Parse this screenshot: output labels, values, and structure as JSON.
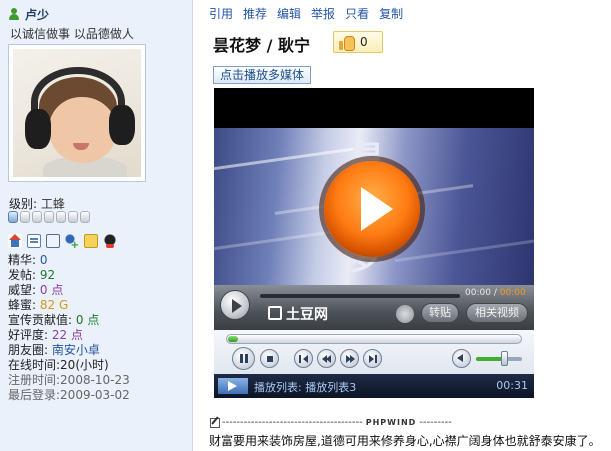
{
  "user": {
    "name": "卢少",
    "motto": "以诚信做事 以品德做人",
    "level_label": "级别:",
    "level_value": "工蜂",
    "stars_total": 7,
    "stars_on": 1,
    "icons": [
      "home-icon",
      "profile-card-icon",
      "document-icon",
      "add-friend-icon",
      "message-icon",
      "qq-icon"
    ]
  },
  "stats": {
    "jinghua_label": "精华:",
    "jinghua_value": "0",
    "posts_label": "发帖:",
    "posts_value": "92",
    "prestige_label": "威望:",
    "prestige_value": "0 点",
    "honey_label": "蜂蜜:",
    "honey_value": "82 G",
    "contrib_label": "宣传贡献值:",
    "contrib_value": "0 点",
    "rating_label": "好评度:",
    "rating_value": "22 点",
    "circle_label": "朋友圈:",
    "circle_value": "南安小卓",
    "online": "在线时间:20(小时)",
    "registered": "注册时间:2008-10-23",
    "last_login": "最后登录:2009-03-02"
  },
  "actions": [
    "引用",
    "推荐",
    "编辑",
    "举报",
    "只看",
    "复制"
  ],
  "post": {
    "title": "昙花梦 / 耿宁",
    "like_count": "0",
    "media_button": "点击播放多媒体"
  },
  "player": {
    "video_chars": [
      "昙",
      "花",
      "梦"
    ],
    "time_elapsed": "00:00",
    "time_separator": "/",
    "time_total": "00:00",
    "brand": "土豆网",
    "btn_repost": "转贴",
    "btn_related": "相关视频",
    "progress": 0.03,
    "volume": 0.6,
    "playlist_text": "播放列表:  播放列表3",
    "playlist_time": "00:31"
  },
  "signature": {
    "brand": "PHPWIND",
    "text": "财富要用来装饰房屋,道德可用来修养身心,心襟广阔身体也就舒泰安康了。"
  },
  "colors": {
    "sidebar_bg": "#eaf1fa",
    "link": "#2656a3",
    "accent_orange": "#ff7a12"
  }
}
